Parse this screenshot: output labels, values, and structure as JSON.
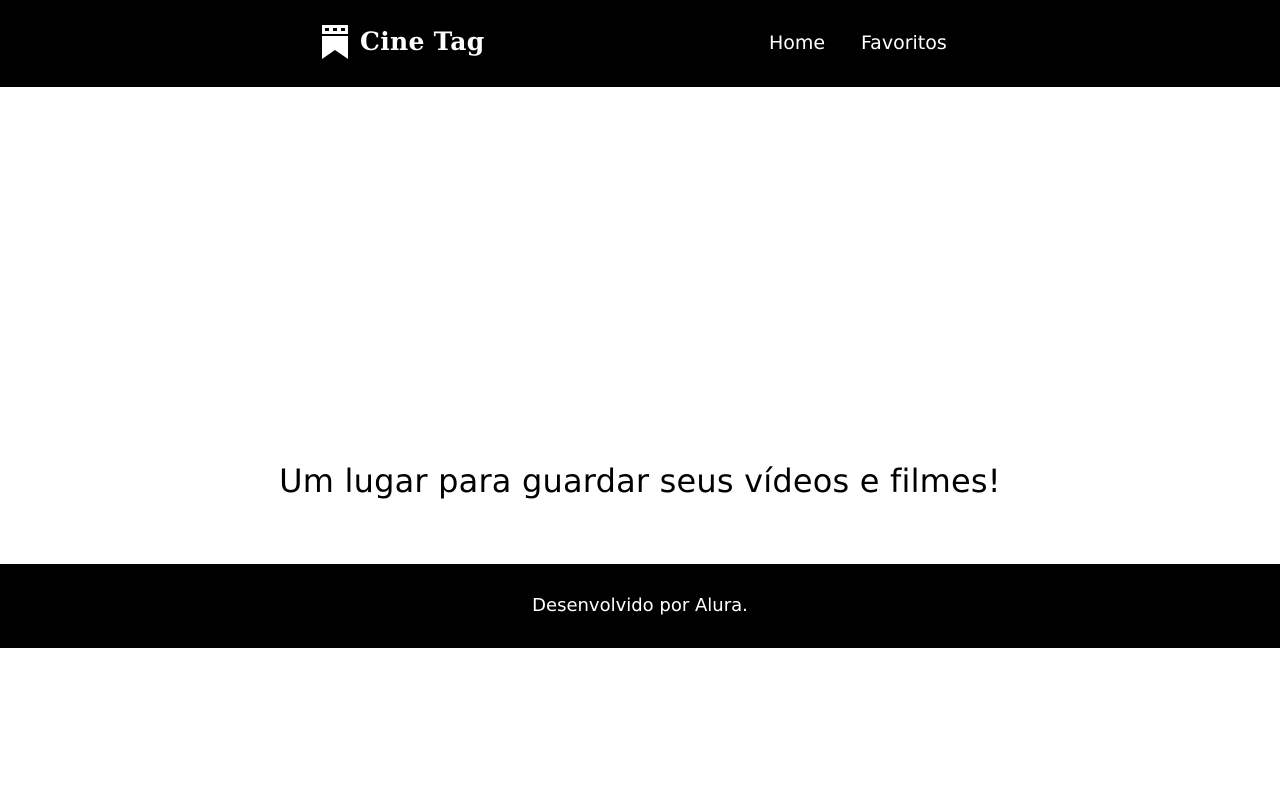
{
  "header": {
    "logo_text": "Cine Tag",
    "logo_icon": "bookmark-film-icon",
    "nav": {
      "home_label": "Home",
      "favorites_label": "Favoritos"
    }
  },
  "main": {
    "headline": "Um lugar para guardar seus vídeos e filmes!"
  },
  "footer": {
    "text": "Desenvolvido por Alura."
  },
  "colors": {
    "header_bg": "#000000",
    "footer_bg": "#000000",
    "page_bg": "#ffffff",
    "header_text": "#ffffff",
    "body_text": "#000000"
  }
}
